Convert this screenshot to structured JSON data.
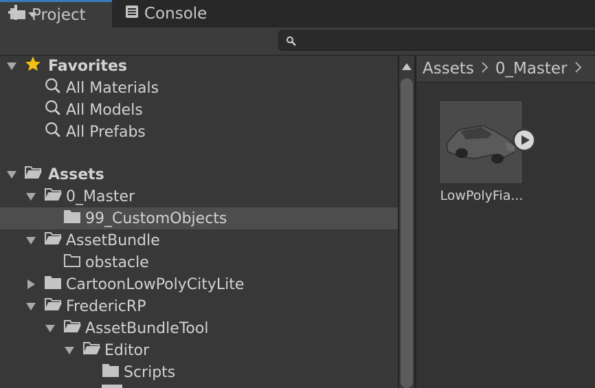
{
  "tabs": [
    {
      "label": "Project",
      "icon": "folder-icon"
    },
    {
      "label": "Console",
      "icon": "console-icon"
    }
  ],
  "toolbar": {
    "create_icon": "plus-icon",
    "dropdown_icon": "chevron-down-icon"
  },
  "search": {
    "placeholder": "",
    "icon": "search-icon"
  },
  "favorites": {
    "label": "Favorites",
    "items": [
      {
        "label": "All Materials"
      },
      {
        "label": "All Models"
      },
      {
        "label": "All Prefabs"
      }
    ]
  },
  "assets": {
    "label": "Assets",
    "items": [
      {
        "label": "0_Master"
      },
      {
        "label": "99_CustomObjects"
      },
      {
        "label": "AssetBundle"
      },
      {
        "label": "obstacle"
      },
      {
        "label": "CartoonLowPolyCityLite"
      },
      {
        "label": "FredericRP"
      },
      {
        "label": "AssetBundleTool"
      },
      {
        "label": "Editor"
      },
      {
        "label": "Scripts"
      }
    ]
  },
  "breadcrumb": {
    "items": [
      "Assets",
      "0_Master"
    ]
  },
  "grid": {
    "items": [
      {
        "label": "LowPolyFia..."
      }
    ]
  },
  "colors": {
    "accent": "#3a79bb",
    "favorite_star": "#f4c20d",
    "selection": "#4d4d4d"
  }
}
